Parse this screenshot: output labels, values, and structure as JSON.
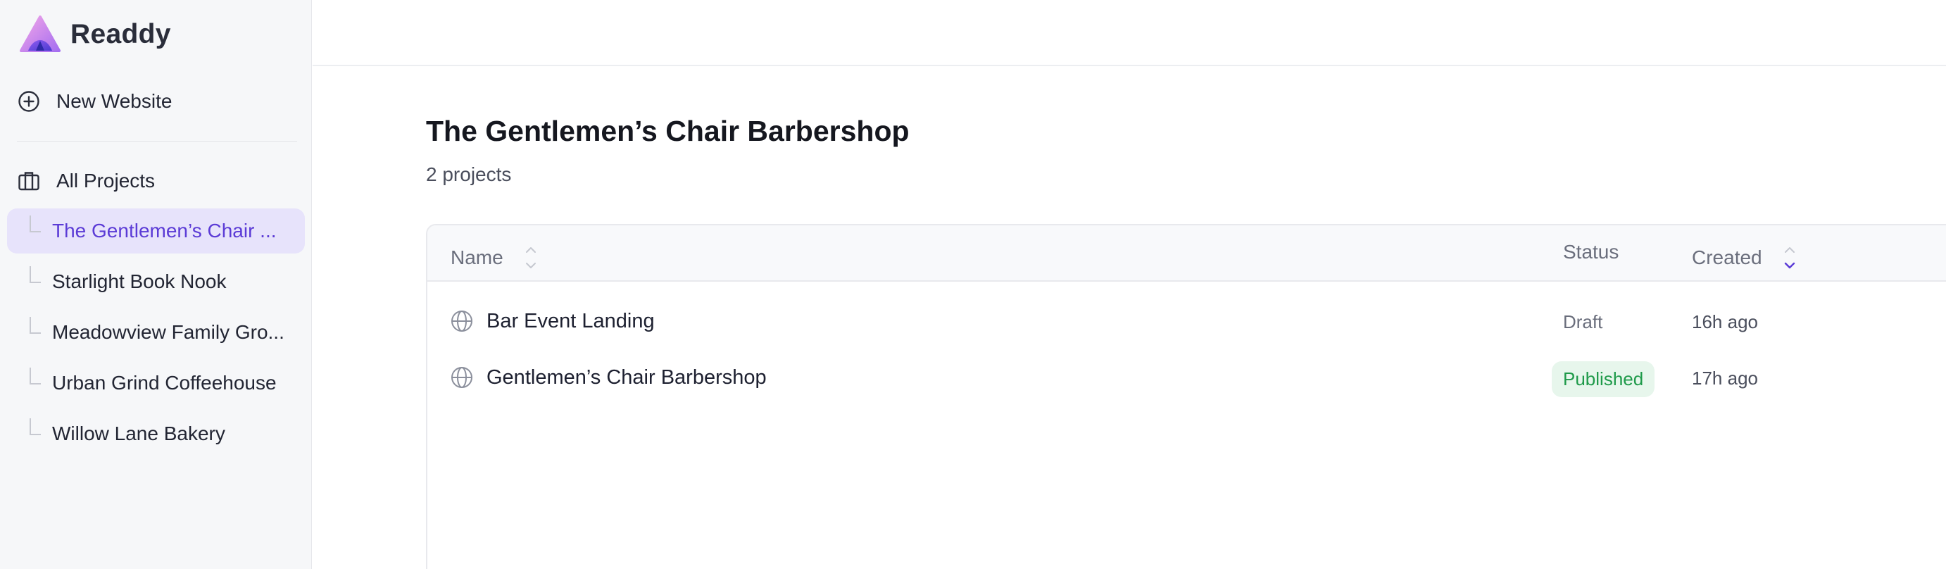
{
  "brand": {
    "name": "Readdy",
    "logo_icon": "readdy-logo-icon"
  },
  "sidebar": {
    "new_website_label": "New Website",
    "all_projects_label": "All Projects",
    "items": [
      {
        "label": "The Gentlemen’s Chair ...",
        "active": true
      },
      {
        "label": "Starlight Book Nook",
        "active": false
      },
      {
        "label": "Meadowview Family Gro...",
        "active": false
      },
      {
        "label": "Urban Grind Coffeehouse",
        "active": false
      },
      {
        "label": "Willow Lane Bakery",
        "active": false
      }
    ]
  },
  "main": {
    "title": "The Gentlemen’s Chair Barbershop",
    "subtitle": "2 projects",
    "table": {
      "columns": {
        "name": "Name",
        "status": "Status",
        "created": "Created"
      },
      "rows": [
        {
          "name": "Bar Event Landing",
          "status": "Draft",
          "created": "16h ago",
          "icon": "globe-icon"
        },
        {
          "name": "Gentlemen’s Chair Barbershop",
          "status": "Published",
          "created": "17h ago",
          "icon": "globe-icon"
        }
      ]
    }
  },
  "colors": {
    "accent": "#5b3bd6",
    "active_bg": "#e7e3fb",
    "published_bg": "#e7f6ec",
    "published_text": "#1f9a4a"
  }
}
